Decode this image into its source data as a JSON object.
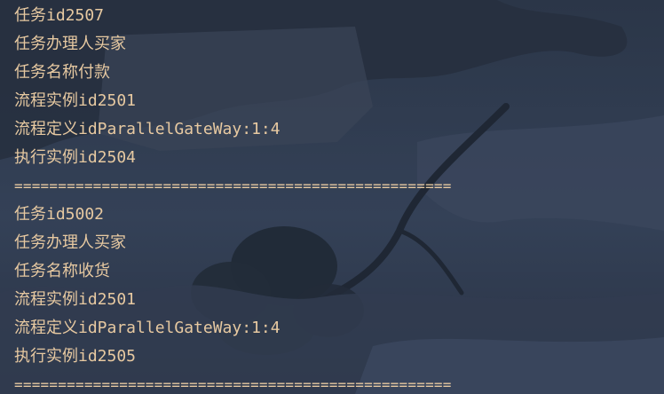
{
  "console": {
    "lines": [
      "任务id2507",
      "任务办理人买家",
      "任务名称付款",
      "流程实例id2501",
      "流程定义idParallelGateWay:1:4",
      "执行实例id2504",
      "==================================================",
      "任务id5002",
      "任务办理人买家",
      "任务名称收货",
      "流程实例id2501",
      "流程定义idParallelGateWay:1:4",
      "执行实例id2505",
      "=================================================="
    ]
  },
  "colors": {
    "text": "#e7c9a1",
    "background": "#2e3a4c"
  }
}
